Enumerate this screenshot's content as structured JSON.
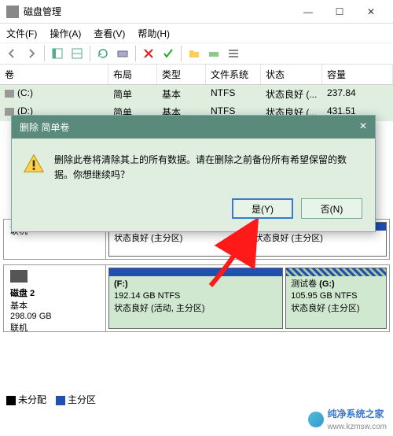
{
  "window": {
    "title": "磁盘管理"
  },
  "winbtns": {
    "min": "—",
    "max": "☐",
    "close": "✕"
  },
  "menu": {
    "file": "文件(F)",
    "action": "操作(A)",
    "view": "查看(V)",
    "help": "帮助(H)"
  },
  "table": {
    "headers": {
      "volume": "卷",
      "layout": "布局",
      "type": "类型",
      "fs": "文件系统",
      "status": "状态",
      "capacity": "容量"
    },
    "rows": [
      {
        "vol": "(C:)",
        "layout": "简单",
        "type": "基本",
        "fs": "NTFS",
        "status": "状态良好 (...",
        "cap": "237.84"
      },
      {
        "vol": "(D:)",
        "layout": "简单",
        "type": "基本",
        "fs": "NTFS",
        "status": "状态良好 (...",
        "cap": "431.51"
      }
    ]
  },
  "disks": {
    "d1": {
      "status": "联机",
      "p1": "状态良好 (主分区)",
      "p2": "状态良好 (主分区)"
    },
    "d2": {
      "name": "磁盘 2",
      "type": "基本",
      "size": "298.09 GB",
      "status": "联机",
      "p1": {
        "label": "(F:)",
        "size": "192.14 GB NTFS",
        "status": "状态良好 (活动, 主分区)"
      },
      "p2": {
        "prefix": "测试卷",
        "label": "(G:)",
        "size": "105.95 GB NTFS",
        "status": "状态良好 (主分区)"
      }
    }
  },
  "legend": {
    "unalloc": "未分配",
    "primary": "主分区"
  },
  "dialog": {
    "title": "删除 简单卷",
    "message": "删除此卷将清除其上的所有数据。请在删除之前备份所有希望保留的数据。你想继续吗？",
    "yes": "是(Y)",
    "no": "否(N)",
    "close": "✕"
  },
  "watermark": {
    "text": "纯净系统之家",
    "url": "www.kzmsw.com"
  }
}
